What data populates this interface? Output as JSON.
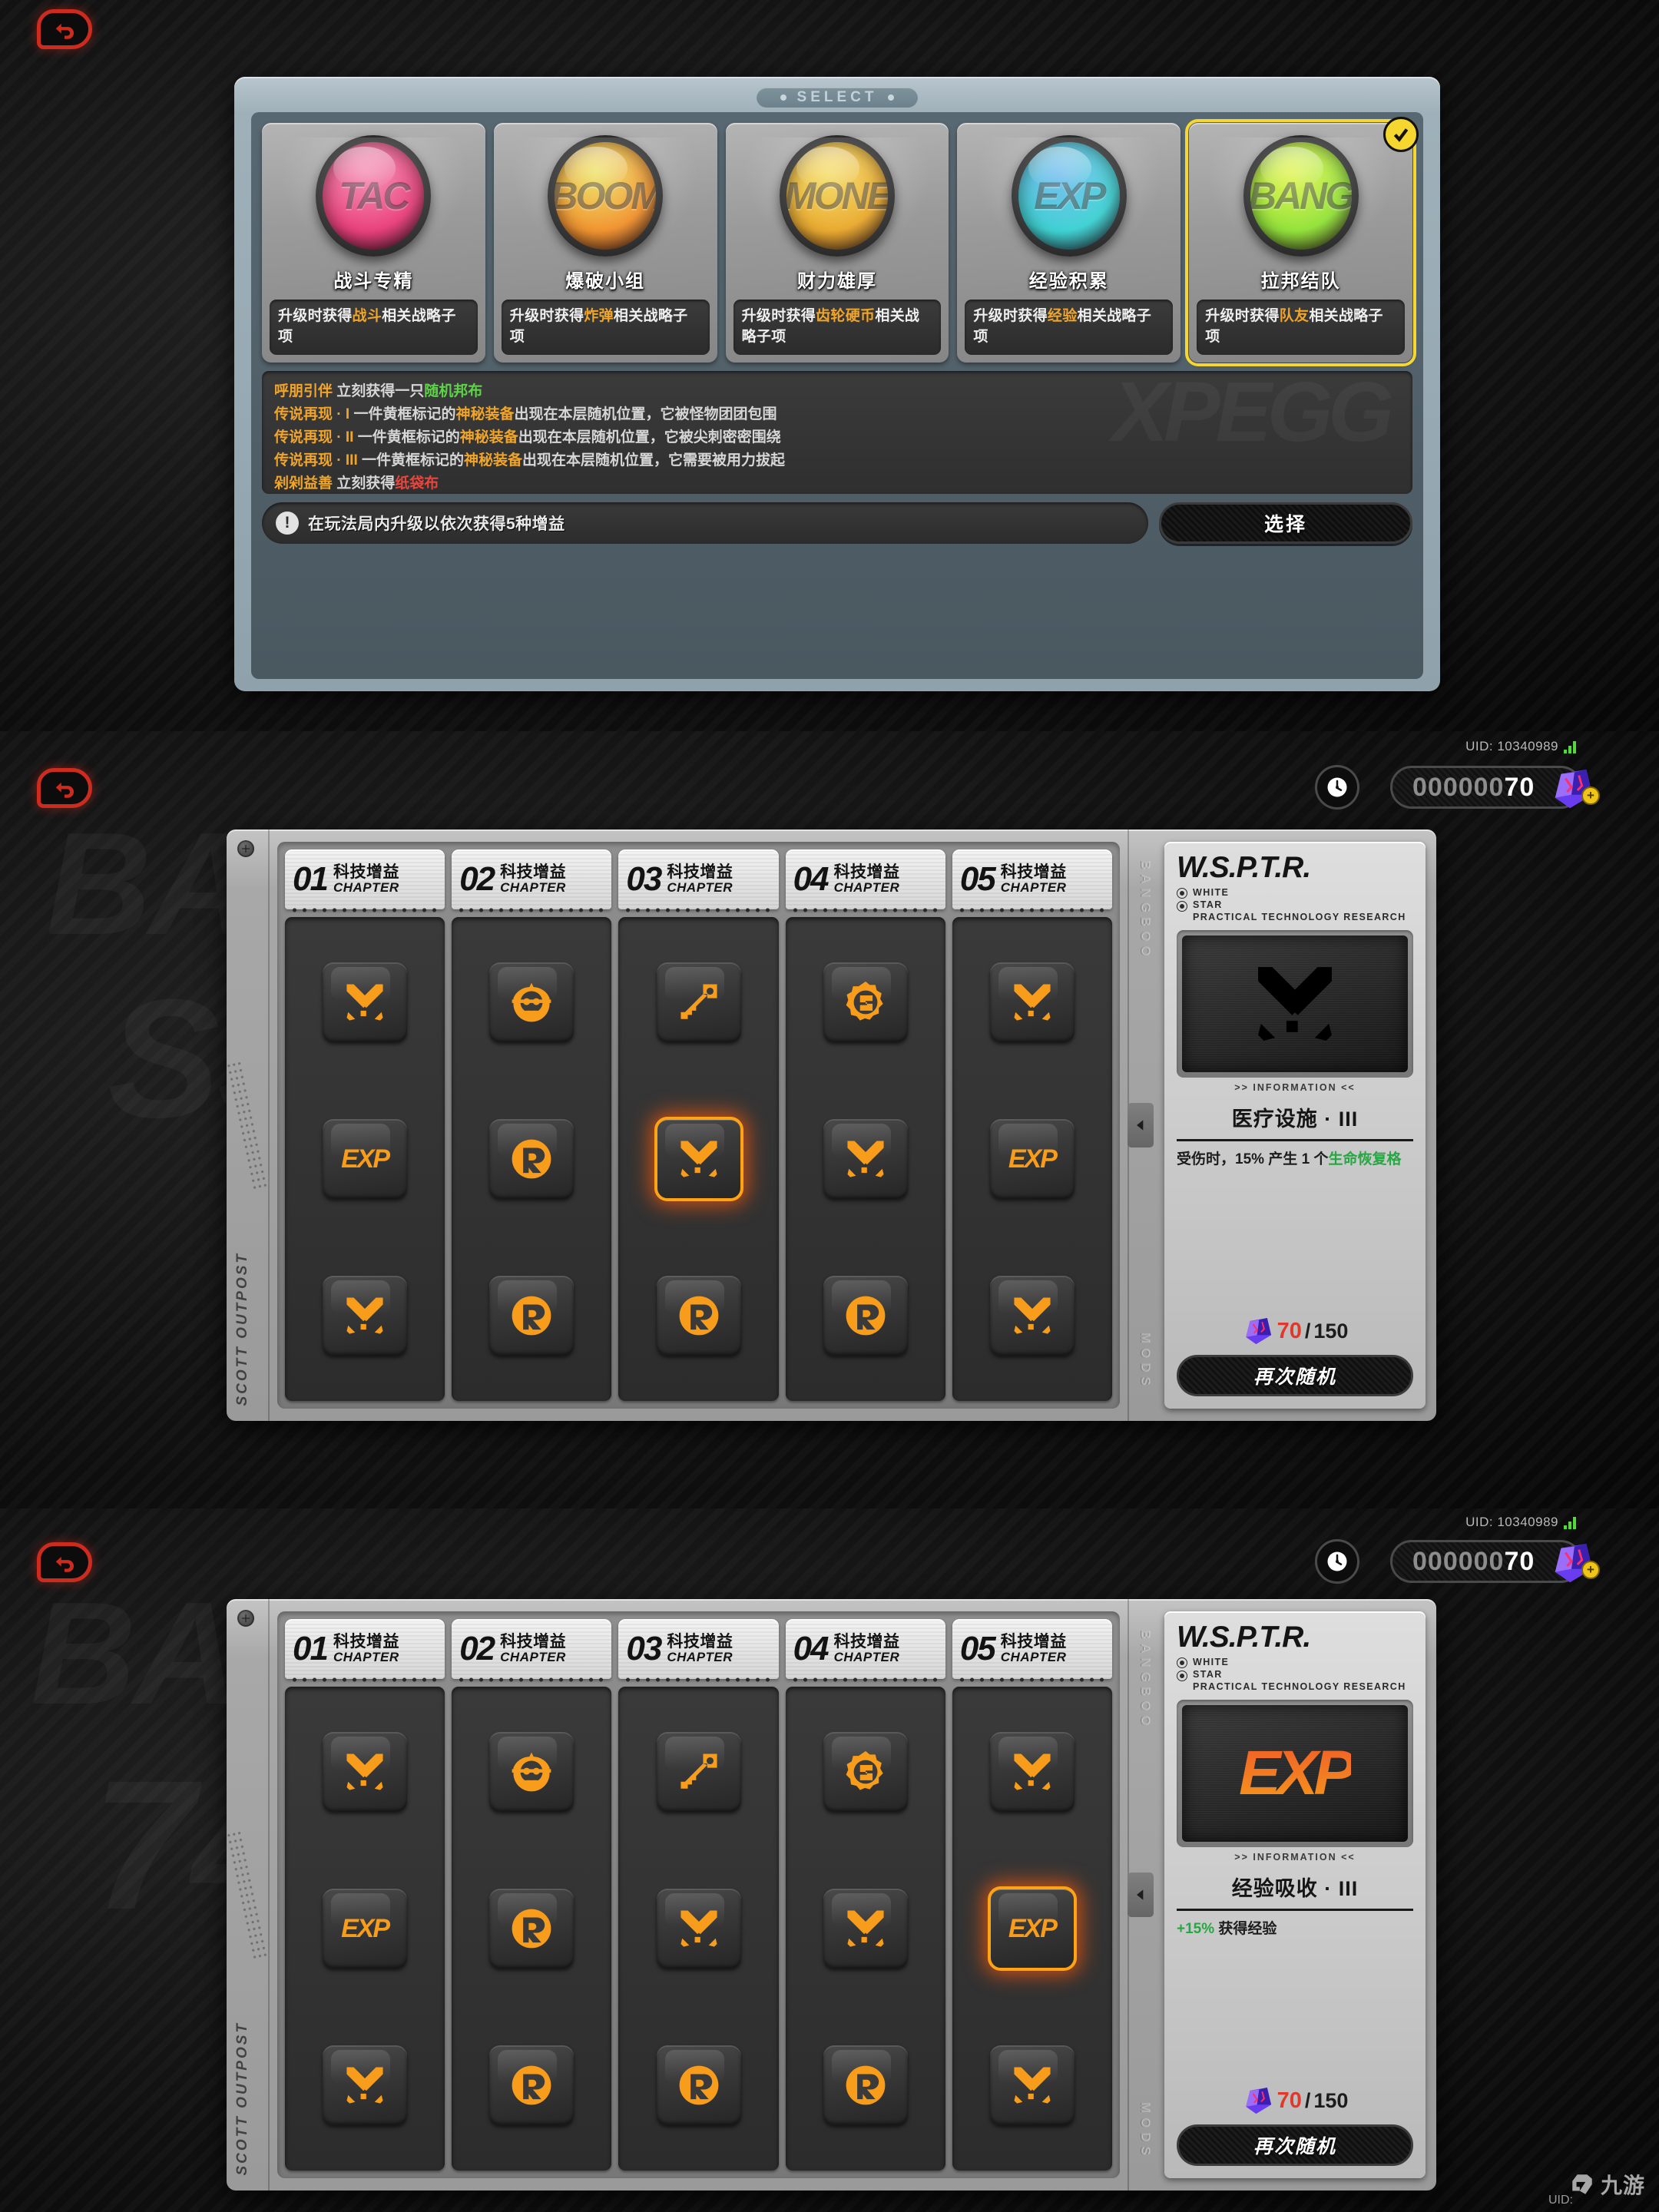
{
  "select_modal": {
    "titlebar": "SELECT",
    "cards": [
      {
        "name": "战斗专精",
        "desc_pre": "升级时获得",
        "desc_hl": "战斗",
        "desc_post": "相关战略子项",
        "orb_text": "TAC",
        "orb_c1": "#e8306f",
        "orb_c2": "#f06a9a",
        "selected": false
      },
      {
        "name": "爆破小组",
        "desc_pre": "升级时获得",
        "desc_hl": "炸弹",
        "desc_post": "相关战略子项",
        "orb_text": "BOOM",
        "orb_c1": "#f08a1e",
        "orb_c2": "#e8d93a",
        "selected": false
      },
      {
        "name": "财力雄厚",
        "desc_pre": "升级时获得",
        "desc_hl": "齿轮硬币",
        "desc_post": "相关战略子项",
        "orb_text": "MONE",
        "orb_c1": "#e8a31e",
        "orb_c2": "#f0d23a",
        "selected": false
      },
      {
        "name": "经验积累",
        "desc_pre": "升级时获得",
        "desc_hl": "经验",
        "desc_post": "相关战略子项",
        "orb_text": "EXP",
        "orb_c1": "#2ecfd0",
        "orb_c2": "#4aa8e8",
        "selected": false
      },
      {
        "name": "拉邦结队",
        "desc_pre": "升级时获得",
        "desc_hl": "队友",
        "desc_post": "相关战略子项",
        "orb_text": "BANG",
        "orb_c1": "#8ae02a",
        "orb_c2": "#d8f01e",
        "selected": true
      }
    ],
    "buff_rows": [
      {
        "name": "呼朋引伴",
        "mid": " 立刻获得一只",
        "tail": "随机邦布",
        "tail_color": "green"
      },
      {
        "name": "传说再现 · I",
        "mid": " 一件黄框标记的",
        "hl": "神秘装备",
        "rest": "出现在本层随机位置，它被怪物团团包围"
      },
      {
        "name": "传说再现 · II",
        "mid": " 一件黄框标记的",
        "hl": "神秘装备",
        "rest": "出现在本层随机位置，它被尖刺密密围绕"
      },
      {
        "name": "传说再现 · III",
        "mid": " 一件黄框标记的",
        "hl": "神秘装备",
        "rest": "出现在本层随机位置，它需要被用力拔起"
      },
      {
        "name": "剁剁益善",
        "mid": " 立刻获得",
        "tail": "纸袋布",
        "tail_color": "red"
      }
    ],
    "ghost_text": "XPEGG",
    "hint_icon": "!",
    "hint_text": "在玩法局内升级以依次获得5种增益",
    "select_button": "选择"
  },
  "hud": {
    "uid_label": "UID: 10340989",
    "currency": "00000070",
    "currency_lead": "000000",
    "currency_tail": "70",
    "clock_icon": "clock-icon",
    "gem_icon": "gem-icon",
    "plus_icon": "+"
  },
  "mods_screen_a": {
    "rail_left_label": "SCOTT OUTPOST",
    "rail_right_top": "BANGBOO",
    "rail_right_bottom": "MODS",
    "chapters": [
      {
        "num": "01",
        "cn": "科技增益",
        "en": "CHAPTER"
      },
      {
        "num": "02",
        "cn": "科技增益",
        "en": "CHAPTER"
      },
      {
        "num": "03",
        "cn": "科技增益",
        "en": "CHAPTER"
      },
      {
        "num": "04",
        "cn": "科技增益",
        "en": "CHAPTER"
      },
      {
        "num": "05",
        "cn": "科技增益",
        "en": "CHAPTER"
      }
    ],
    "slots": [
      [
        "swords-icon",
        "exp-icon",
        "swords-icon"
      ],
      [
        "skull-gear-icon",
        "r-circle-icon",
        "r-circle-icon"
      ],
      [
        "key-icon",
        "swords-icon",
        "r-circle-icon"
      ],
      [
        "gear-coin-icon",
        "swords-icon",
        "r-circle-icon"
      ],
      [
        "swords-icon",
        "exp-icon",
        "swords-icon"
      ]
    ],
    "active_slot": {
      "col": 2,
      "row": 1
    },
    "info": {
      "brand": "W.S.P.T.R.",
      "sub_lines": [
        "WHITE",
        "STAR",
        "PRACTICAL TECHNOLOGY  RESEARCH"
      ],
      "screen_icon": "swords-icon",
      "info_label": ">> INFORMATION <<",
      "mod_title": "医疗设施 · III",
      "desc_pre": "受伤时，15% 产生 1 个",
      "desc_hl": "生命恢复格",
      "cost_have": "70",
      "cost_sep": "/",
      "cost_max": "150",
      "reroll_button": "再次随机"
    }
  },
  "mods_screen_b": {
    "rail_left_label": "SCOTT OUTPOST",
    "rail_right_top": "BANGBOO",
    "rail_right_bottom": "MODS",
    "chapters": [
      {
        "num": "01",
        "cn": "科技增益",
        "en": "CHAPTER"
      },
      {
        "num": "02",
        "cn": "科技增益",
        "en": "CHAPTER"
      },
      {
        "num": "03",
        "cn": "科技增益",
        "en": "CHAPTER"
      },
      {
        "num": "04",
        "cn": "科技增益",
        "en": "CHAPTER"
      },
      {
        "num": "05",
        "cn": "科技增益",
        "en": "CHAPTER"
      }
    ],
    "slots": [
      [
        "swords-icon",
        "exp-icon",
        "swords-icon"
      ],
      [
        "skull-gear-icon",
        "r-circle-icon",
        "r-circle-icon"
      ],
      [
        "key-icon",
        "swords-icon",
        "r-circle-icon"
      ],
      [
        "gear-coin-icon",
        "swords-icon",
        "r-circle-icon"
      ],
      [
        "swords-icon",
        "exp-icon",
        "swords-icon"
      ]
    ],
    "active_slot": {
      "col": 4,
      "row": 1
    },
    "info": {
      "brand": "W.S.P.T.R.",
      "sub_lines": [
        "WHITE",
        "STAR",
        "PRACTICAL TECHNOLOGY  RESEARCH"
      ],
      "screen_icon": "exp-icon",
      "info_label": ">> INFORMATION <<",
      "mod_title": "经验吸收 · III",
      "desc_hl2": "+15%",
      "desc_post2": " 获得经验",
      "cost_have": "70",
      "cost_sep": "/",
      "cost_max": "150",
      "reroll_button": "再次随机"
    }
  },
  "watermark": {
    "logo_text": "九游",
    "uid_bottom": "UID:"
  },
  "colors": {
    "accent_orange": "#f79c1b",
    "accent_yellow": "#f5d72f",
    "accent_red": "#cc2b1d",
    "green": "#5fd24a",
    "bg_dark": "#0a0a0a"
  }
}
